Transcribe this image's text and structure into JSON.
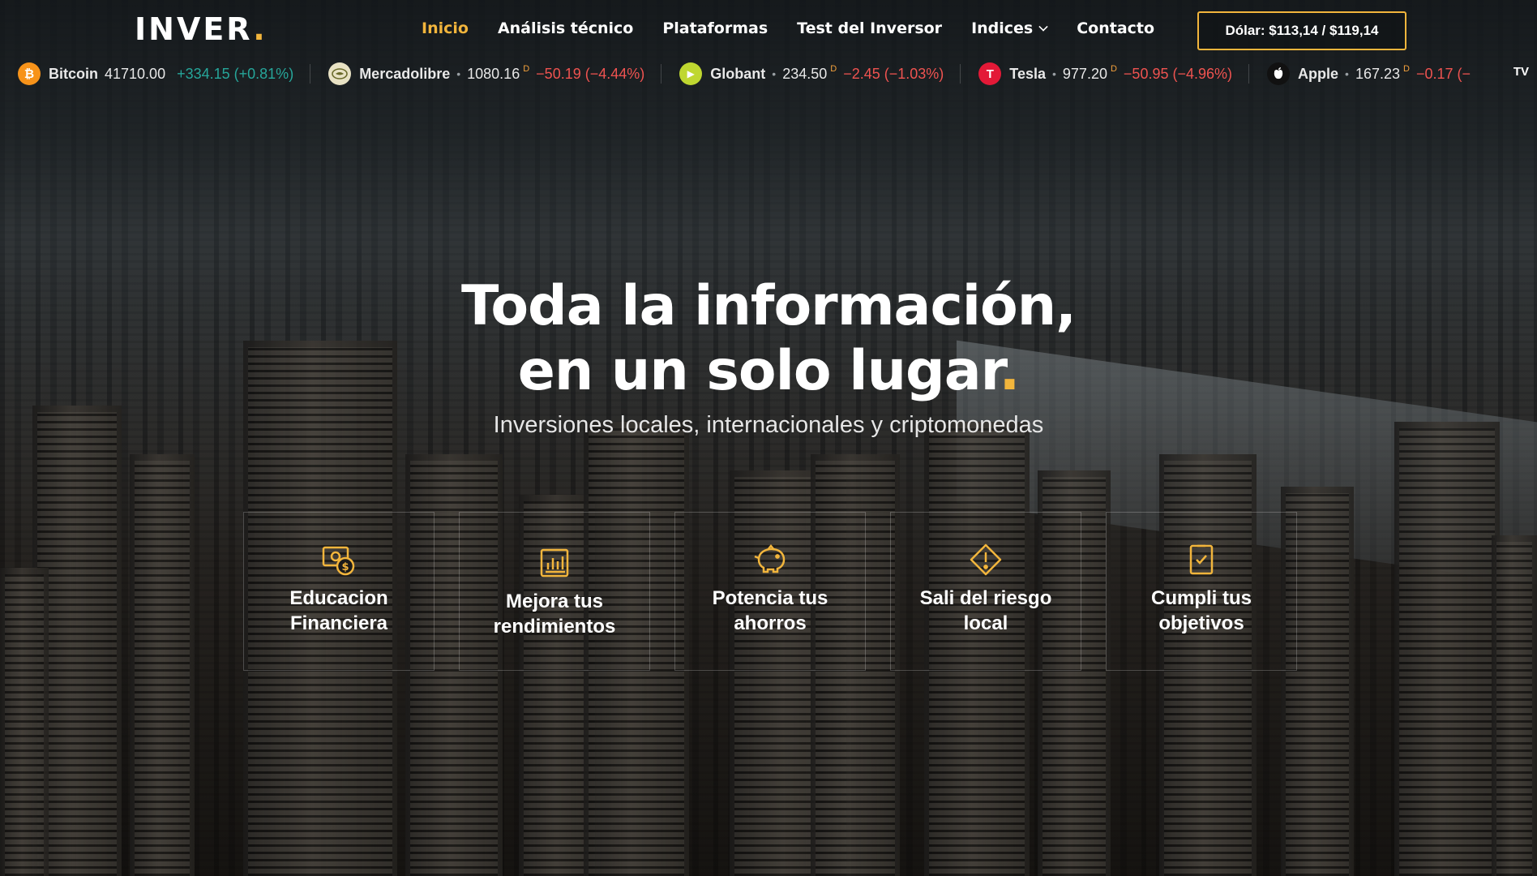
{
  "brand": {
    "name": "INVER",
    "dot": "."
  },
  "nav": {
    "items": [
      {
        "label": "Inicio",
        "active": true
      },
      {
        "label": "Análisis técnico"
      },
      {
        "label": "Plataformas"
      },
      {
        "label": "Test del Inversor"
      },
      {
        "label": "Indices",
        "has_dropdown": true
      },
      {
        "label": "Contacto"
      }
    ]
  },
  "dolar": {
    "label": "Dólar: $113,14 / $119,14"
  },
  "ticker": [
    {
      "name": "Bitcoin",
      "icon": "bitcoin-icon",
      "icon_color": "#f7931a",
      "icon_glyph": "₿",
      "price": "41710.00",
      "delayed": "",
      "change": "+334.15 (+0.81%)",
      "direction": "up",
      "sep": ""
    },
    {
      "name": "Mercadolibre",
      "icon": "mercadolibre-icon",
      "icon_color": "#e8e2c4",
      "icon_glyph": "",
      "price": "1080.16",
      "delayed": "D",
      "change": "−50.19 (−4.44%)",
      "direction": "down",
      "sep": "•"
    },
    {
      "name": "Globant",
      "icon": "globant-icon",
      "icon_color": "#bfd730",
      "icon_glyph": "▶",
      "price": "234.50",
      "delayed": "D",
      "change": "−2.45 (−1.03%)",
      "direction": "down",
      "sep": "•"
    },
    {
      "name": "Tesla",
      "icon": "tesla-icon",
      "icon_color": "#e31937",
      "icon_glyph": "T",
      "price": "977.20",
      "delayed": "D",
      "change": "−50.95 (−4.96%)",
      "direction": "down",
      "sep": "•"
    },
    {
      "name": "Apple",
      "icon": "apple-icon",
      "icon_color": "#111111",
      "icon_glyph": "",
      "price": "167.23",
      "delayed": "D",
      "change": "−0.17 (−",
      "direction": "down",
      "sep": "•"
    }
  ],
  "tradingview_mark": "TV",
  "hero": {
    "title_line1": "Toda la información,",
    "title_line2": "en un solo lugar",
    "title_dot": ".",
    "subtitle": "Inversiones locales, internacionales y criptomonedas"
  },
  "features": [
    {
      "line1": "Educacion",
      "line2": "Financiera",
      "icon": "money-education-icon"
    },
    {
      "line1": "Mejora tus",
      "line2": "rendimientos",
      "icon": "bar-chart-icon"
    },
    {
      "line1": "Potencia tus",
      "line2": "ahorros",
      "icon": "piggy-bank-icon"
    },
    {
      "line1": "Sali del riesgo",
      "line2": "local",
      "icon": "warning-icon"
    },
    {
      "line1": "Cumpli tus",
      "line2": "objetivos",
      "icon": "clipboard-check-icon"
    }
  ],
  "colors": {
    "accent": "#f2b53c",
    "up": "#26a69a",
    "down": "#ef5350"
  }
}
